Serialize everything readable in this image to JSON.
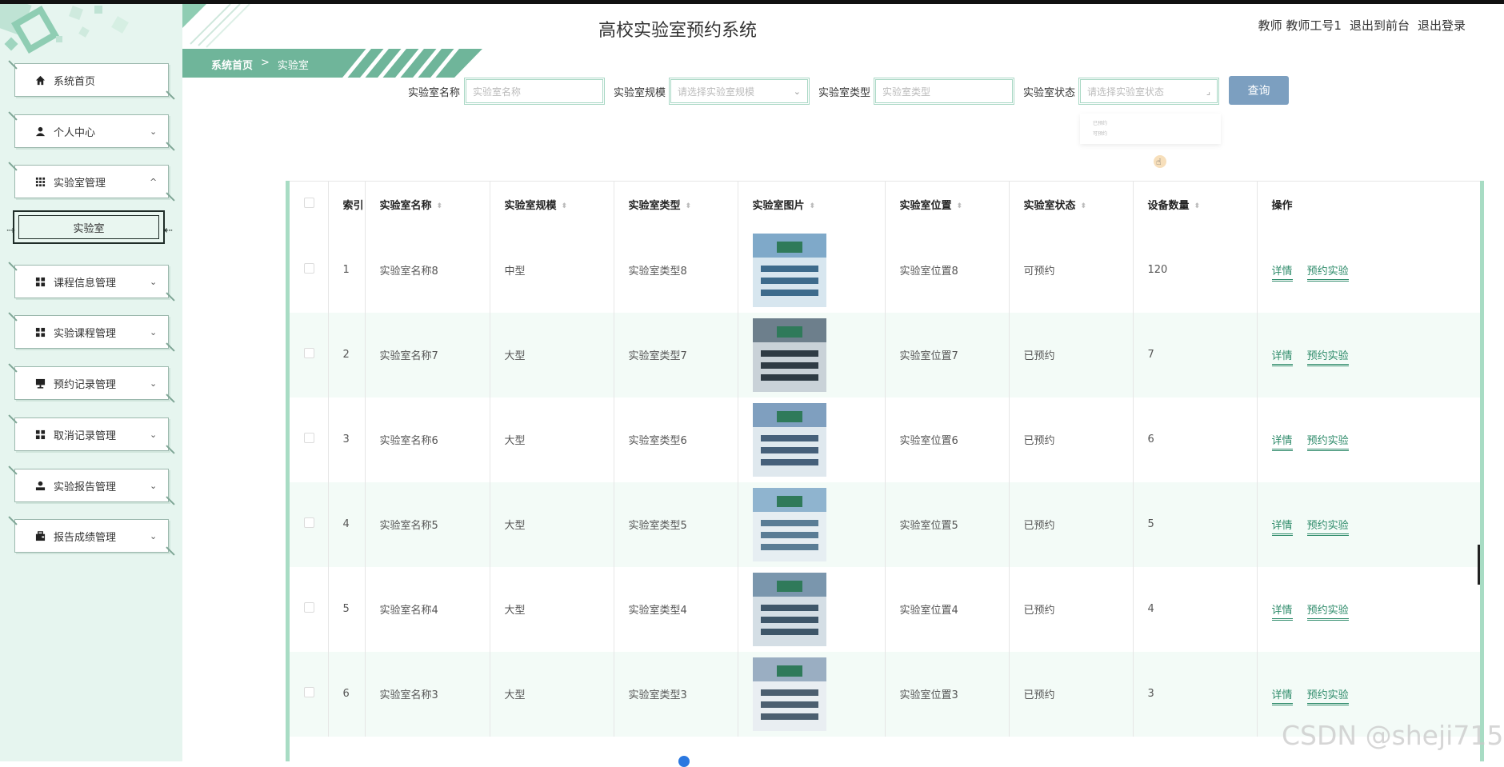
{
  "app_title": "高校实验室预约系统",
  "header_links": [
    "教师 教师工号1",
    "退出到前台",
    "退出登录"
  ],
  "breadcrumb": {
    "home": "系统首页",
    "separator": ">",
    "current": "实验室"
  },
  "sidebar": {
    "items": [
      {
        "label": "系统首页",
        "icon": "home-icon",
        "chevron": false
      },
      {
        "label": "个人中心",
        "icon": "user-icon",
        "chevron": "down"
      },
      {
        "label": "实验室管理",
        "icon": "grid-icon",
        "chevron": "up"
      },
      {
        "label": "课程信息管理",
        "icon": "grid-icon",
        "chevron": "down"
      },
      {
        "label": "实验课程管理",
        "icon": "grid-icon",
        "chevron": "down"
      },
      {
        "label": "预约记录管理",
        "icon": "chalkboard-icon",
        "chevron": "down"
      },
      {
        "label": "取消记录管理",
        "icon": "grid-icon",
        "chevron": "down"
      },
      {
        "label": "实验报告管理",
        "icon": "user-icon",
        "chevron": "down"
      },
      {
        "label": "报告成绩管理",
        "icon": "briefcase-icon",
        "chevron": "down"
      }
    ],
    "sub_item": {
      "label": "实验室"
    }
  },
  "search": {
    "name_label": "实验室名称",
    "name_placeholder": "实验室名称",
    "scale_label": "实验室规模",
    "scale_placeholder": "请选择实验室规模",
    "type_label": "实验室类型",
    "type_placeholder": "实验室类型",
    "status_label": "实验室状态",
    "status_placeholder": "请选择实验室状态",
    "query_label": "查询",
    "status_options": [
      "已预约",
      "可预约"
    ]
  },
  "table": {
    "headers": {
      "index": "索引",
      "name": "实验室名称",
      "scale": "实验室规模",
      "type": "实验室类型",
      "image": "实验室图片",
      "location": "实验室位置",
      "status": "实验室状态",
      "count": "设备数量",
      "ops": "操作"
    },
    "rows": [
      {
        "index": "1",
        "name": "实验室名称8",
        "scale": "中型",
        "type": "实验室类型8",
        "location": "实验室位置8",
        "status": "可预约",
        "count": "120"
      },
      {
        "index": "2",
        "name": "实验室名称7",
        "scale": "大型",
        "type": "实验室类型7",
        "location": "实验室位置7",
        "status": "已预约",
        "count": "7"
      },
      {
        "index": "3",
        "name": "实验室名称6",
        "scale": "大型",
        "type": "实验室类型6",
        "location": "实验室位置6",
        "status": "已预约",
        "count": "6"
      },
      {
        "index": "4",
        "name": "实验室名称5",
        "scale": "大型",
        "type": "实验室类型5",
        "location": "实验室位置5",
        "status": "已预约",
        "count": "5"
      },
      {
        "index": "5",
        "name": "实验室名称4",
        "scale": "大型",
        "type": "实验室类型4",
        "location": "实验室位置4",
        "status": "已预约",
        "count": "4"
      },
      {
        "index": "6",
        "name": "实验室名称3",
        "scale": "大型",
        "type": "实验室类型3",
        "location": "实验室位置3",
        "status": "已预约",
        "count": "3"
      }
    ],
    "op_detail": "详情",
    "op_reserve": "预约实验"
  },
  "watermark": "CSDN @sheji715",
  "colors": {
    "accent": "#2e8b6a",
    "sidebar_bg": "#e6f5ef",
    "band": "#6fb59a",
    "query_btn": "#7c9fc0",
    "row_alt": "#f3fbf7"
  }
}
